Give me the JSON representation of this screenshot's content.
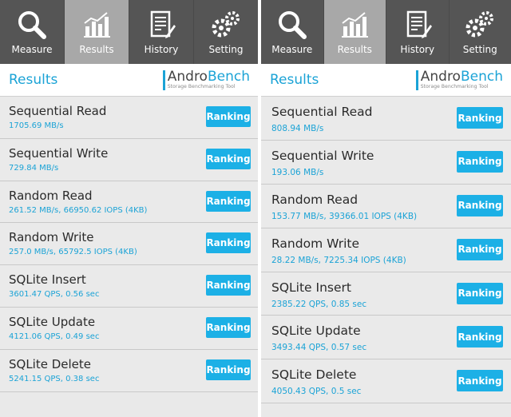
{
  "colors": {
    "accent": "#1ba3d6",
    "button": "#1cb0e6",
    "tabbar": "#555555",
    "tab_active": "#a8a8a8"
  },
  "tabs": [
    {
      "label": "Measure",
      "icon": "search-icon"
    },
    {
      "label": "Results",
      "icon": "bar-chart-icon"
    },
    {
      "label": "History",
      "icon": "document-icon"
    },
    {
      "label": "Setting",
      "icon": "gears-icon"
    }
  ],
  "header": {
    "title": "Results",
    "brand_prefix": "Andro",
    "brand_suffix": "Bench",
    "brand_sub": "Storage Benchmarking Tool"
  },
  "ranking_label": "Ranking",
  "left": {
    "rows": [
      {
        "name": "Sequential Read",
        "value": "1705.69 MB/s"
      },
      {
        "name": "Sequential Write",
        "value": "729.84 MB/s"
      },
      {
        "name": "Random Read",
        "value": "261.52 MB/s, 66950.62 IOPS (4KB)"
      },
      {
        "name": "Random Write",
        "value": "257.0 MB/s, 65792.5 IOPS (4KB)"
      },
      {
        "name": "SQLite Insert",
        "value": "3601.47 QPS, 0.56 sec"
      },
      {
        "name": "SQLite Update",
        "value": "4121.06 QPS, 0.49 sec"
      },
      {
        "name": "SQLite Delete",
        "value": "5241.15 QPS, 0.38 sec"
      }
    ]
  },
  "right": {
    "rows": [
      {
        "name": "Sequential Read",
        "value": "808.94 MB/s"
      },
      {
        "name": "Sequential Write",
        "value": "193.06 MB/s"
      },
      {
        "name": "Random Read",
        "value": "153.77 MB/s, 39366.01 IOPS (4KB)"
      },
      {
        "name": "Random Write",
        "value": "28.22 MB/s, 7225.34 IOPS (4KB)"
      },
      {
        "name": "SQLite Insert",
        "value": "2385.22 QPS, 0.85 sec"
      },
      {
        "name": "SQLite Update",
        "value": "3493.44 QPS, 0.57 sec"
      },
      {
        "name": "SQLite Delete",
        "value": "4050.43 QPS, 0.5 sec"
      }
    ]
  }
}
